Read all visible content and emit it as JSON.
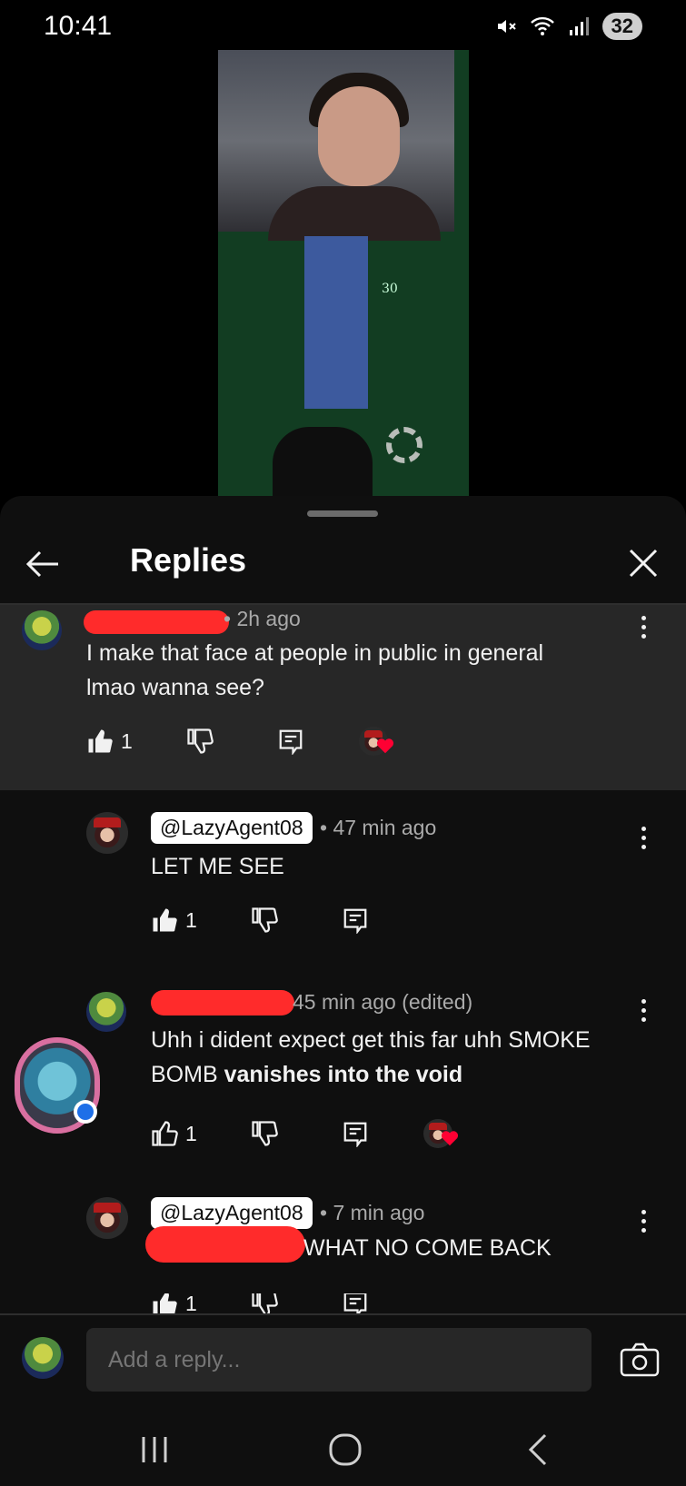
{
  "status_bar": {
    "time": "10:41",
    "battery": "32"
  },
  "video": {
    "overlay_number": "30"
  },
  "sheet": {
    "title": "Replies"
  },
  "comments": [
    {
      "time": "2h ago",
      "text_line1": "I make that face at people in public in general",
      "text_line2": "lmao wanna see?",
      "likes": "1"
    },
    {
      "handle": "@LazyAgent08",
      "time": "47 min ago",
      "text": "LET ME SEE",
      "likes": "1"
    },
    {
      "time": "45 min ago (edited)",
      "text_line1": "Uhh i dident expect get this far uhh SMOKE",
      "text_line2_plain": "BOMB ",
      "text_line2_bold": "vanishes into the void",
      "likes": "1"
    },
    {
      "handle": "@LazyAgent08",
      "time": "7 min ago",
      "text": "WHAT NO COME BACK",
      "likes": "1"
    }
  ],
  "reply_input": {
    "placeholder": "Add a reply..."
  },
  "colors": {
    "redaction": "#ff2b2b",
    "heart": "#ff0033",
    "highlight_bg": "#272727"
  }
}
